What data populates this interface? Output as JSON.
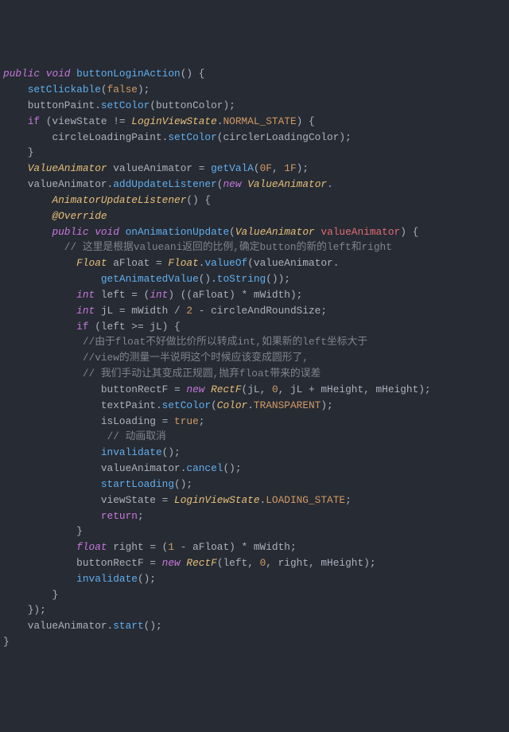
{
  "language": "java",
  "theme": "atom-one-dark",
  "tokens": {
    "l1": {
      "t1": "public",
      "t2": "void",
      "t3": "buttonLoginAction",
      "t4": "() {"
    },
    "l2": {
      "t1": "setClickable",
      "t2": "(",
      "t3": "false",
      "t4": ");"
    },
    "l3": {
      "t1": "buttonPaint.",
      "t2": "setColor",
      "t3": "(buttonColor);"
    },
    "l4": {
      "t1": "if",
      "t2": " (viewState != ",
      "t3": "LoginViewState",
      "t4": ".",
      "t5": "NORMAL_STATE",
      "t6": ") {"
    },
    "l5": {
      "t1": "circleLoadingPaint.",
      "t2": "setColor",
      "t3": "(circlerLoadingColor);"
    },
    "l6": {
      "t1": "}"
    },
    "l7": {
      "t1": "ValueAnimator",
      "t2": " valueAnimator = ",
      "t3": "getValA",
      "t4": "(",
      "t5": "0F",
      "t6": ", ",
      "t7": "1F",
      "t8": ");"
    },
    "l8": {
      "t1": "valueAnimator.",
      "t2": "addUpdateListener",
      "t3": "(",
      "t4": "new",
      "t5": " ",
      "t6": "ValueAnimator",
      "t7": "."
    },
    "l9": {
      "t1": "AnimatorUpdateListener",
      "t2": "() {"
    },
    "l10": {
      "t1": "@Override"
    },
    "l11": {
      "t1": "public",
      "t2": " ",
      "t3": "void",
      "t4": " ",
      "t5": "onAnimationUpdate",
      "t6": "(",
      "t7": "ValueAnimator",
      "t8": " ",
      "t9": "valueAnimator",
      "t10": ") {"
    },
    "l12": {
      "t1": "// 这里是根据valueani返回的比例,确定button的新的left和right"
    },
    "l13": {
      "t1": "Float",
      "t2": " aFloat = ",
      "t3": "Float",
      "t4": ".",
      "t5": "valueOf",
      "t6": "(valueAnimator."
    },
    "l14": {
      "t1": "getAnimatedValue",
      "t2": "().",
      "t3": "toString",
      "t4": "());"
    },
    "l15": {
      "t1": "int",
      "t2": " left = (",
      "t3": "int",
      "t4": ") ((aFloat) * mWidth);"
    },
    "l16": {
      "t1": "int",
      "t2": " jL = mWidth / ",
      "t3": "2",
      "t4": " - circleAndRoundSize;"
    },
    "l17": {
      "t1": "if",
      "t2": " (left >= jL) {"
    },
    "l18": {
      "t1": "//由于float不好做比价所以转成int,如果新的left坐标大于"
    },
    "l19": {
      "t1": "//view的测量一半说明这个时候应该变成圆形了,"
    },
    "l20": {
      "t1": "// 我们手动让其变成正规圆,抛弃float带来的误差"
    },
    "l21": {
      "t1": "buttonRectF = ",
      "t2": "new",
      "t3": " ",
      "t4": "RectF",
      "t5": "(jL, ",
      "t6": "0",
      "t7": ", jL + mHeight, mHeight);"
    },
    "l22": {
      "t1": "textPaint.",
      "t2": "setColor",
      "t3": "(",
      "t4": "Color",
      "t5": ".",
      "t6": "TRANSPARENT",
      "t7": ");"
    },
    "l23": {
      "t1": "isLoading = ",
      "t2": "true",
      "t3": ";"
    },
    "l24": {
      "t1": "// 动画取消"
    },
    "l25": {
      "t1": "invalidate",
      "t2": "();"
    },
    "l26": {
      "t1": "valueAnimator.",
      "t2": "cancel",
      "t3": "();"
    },
    "l27": {
      "t1": "startLoading",
      "t2": "();"
    },
    "l28": {
      "t1": "viewState = ",
      "t2": "LoginViewState",
      "t3": ".",
      "t4": "LOADING_STATE",
      "t5": ";"
    },
    "l29": {
      "t1": "return",
      "t2": ";"
    },
    "l30": {
      "t1": "}"
    },
    "l31": {
      "t1": "float",
      "t2": " right = (",
      "t3": "1",
      "t4": " - aFloat) * mWidth;"
    },
    "l32": {
      "t1": "buttonRectF = ",
      "t2": "new",
      "t3": " ",
      "t4": "RectF",
      "t5": "(left, ",
      "t6": "0",
      "t7": ", right, mHeight);"
    },
    "l33": {
      "t1": "invalidate",
      "t2": "();"
    },
    "l34": {
      "t1": "}"
    },
    "l35": {
      "t1": "});"
    },
    "l36": {
      "t1": "valueAnimator.",
      "t2": "start",
      "t3": "();"
    },
    "l37": {
      "t1": "}"
    }
  }
}
